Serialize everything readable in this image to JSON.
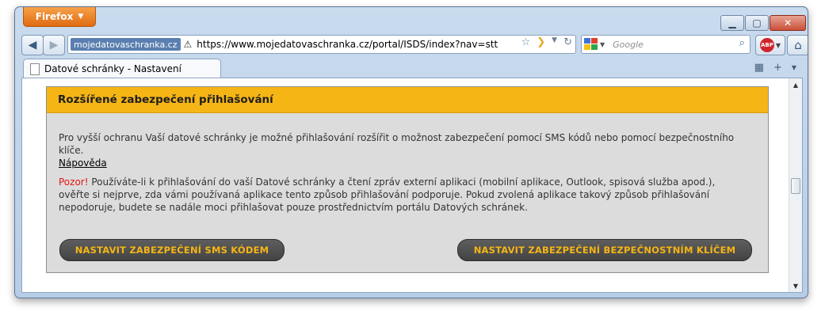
{
  "browser": {
    "menu_button": "Firefox",
    "site_identity": "mojedatovaschranka.cz",
    "url": "https://www.mojedatovaschranka.cz/portal/ISDS/index?nav=stt",
    "search_placeholder": "Google",
    "tab_title": "Datové schránky - Nastavení",
    "addon_badge": "ABP"
  },
  "panel": {
    "title": "Rozšířené zabezpečení přihlašování",
    "intro_text": "Pro vyšší ochranu Vaší datové schránky je možné přihlašování rozšířit o možnost zabezpečení pomocí SMS kódů nebo pomocí bezpečnostního klíče.",
    "help_link": "Nápověda",
    "warning_label": "Pozor!",
    "warning_text": "Používáte-li k přihlašování do vaší Datové schránky a čtení zpráv externí aplikaci (mobilní aplikace, Outlook, spisová služba apod.), ověřte si nejprve, zda vámi používaná aplikace tento způsob přihlašování podporuje. Pokud zvolená aplikace takový způsob přihlašování nepodoruje, budete se nadále moci přihlašovat pouze prostřednictvím portálu Datových schránek.",
    "sms_button": "NASTAVIT ZABEZPEČENÍ SMS KÓDEM",
    "key_button": "NASTAVIT ZABEZPEČENÍ BEZPEČNOSTNÍM KLÍČEM"
  },
  "colors": {
    "accent": "#f5b515",
    "panel_bg": "#dcdcdc",
    "button_bg": "#4a4a4a",
    "warning": "#e21616"
  }
}
